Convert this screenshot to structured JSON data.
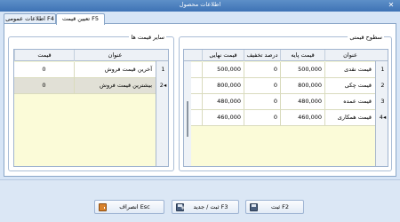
{
  "window": {
    "title": "اطلاعات محصول",
    "close_glyph": "✕"
  },
  "tabs": [
    {
      "label": "تعیین قیمت F5",
      "active": true
    },
    {
      "label": "اطلاعات عمومی F4",
      "active": false
    }
  ],
  "price_levels": {
    "title": "سطوح قیمتی",
    "columns": {
      "title": "عنوان",
      "base_price": "قیمت پایه",
      "discount": "درصد تخفیف",
      "final_price": "قیمت نهایی"
    },
    "rows": [
      {
        "index": "1",
        "title": "قیمت نقدی",
        "base_price": "500,000",
        "discount": "0",
        "final_price": "500,000"
      },
      {
        "index": "2",
        "title": "قیمت چکی",
        "base_price": "800,000",
        "discount": "0",
        "final_price": "800,000"
      },
      {
        "index": "3",
        "title": "قیمت عمده",
        "base_price": "480,000",
        "discount": "0",
        "final_price": "480,000"
      },
      {
        "index": "4",
        "title": "قیمت همکاری",
        "base_price": "460,000",
        "discount": "0",
        "final_price": "460,000",
        "selected": true,
        "marker": "◂"
      }
    ]
  },
  "other_prices": {
    "title": "سایر قیمت ها",
    "columns": {
      "title": "عنوان",
      "price": "قیمت"
    },
    "rows": [
      {
        "index": "1",
        "title": "آخرین قیمت فروش",
        "price": "0"
      },
      {
        "index": "2",
        "title": "بیشترین قیمت فروش",
        "price": "0",
        "selected": true,
        "marker": "◂"
      }
    ]
  },
  "buttons": {
    "save": "ثبت F2",
    "save_new": "ثبت / جدید F3",
    "cancel": "انصراف Esc"
  },
  "colors": {
    "accent": "#3e73b5",
    "grid_background": "#fbfbd8",
    "selected_row": "#e1e0d6"
  }
}
